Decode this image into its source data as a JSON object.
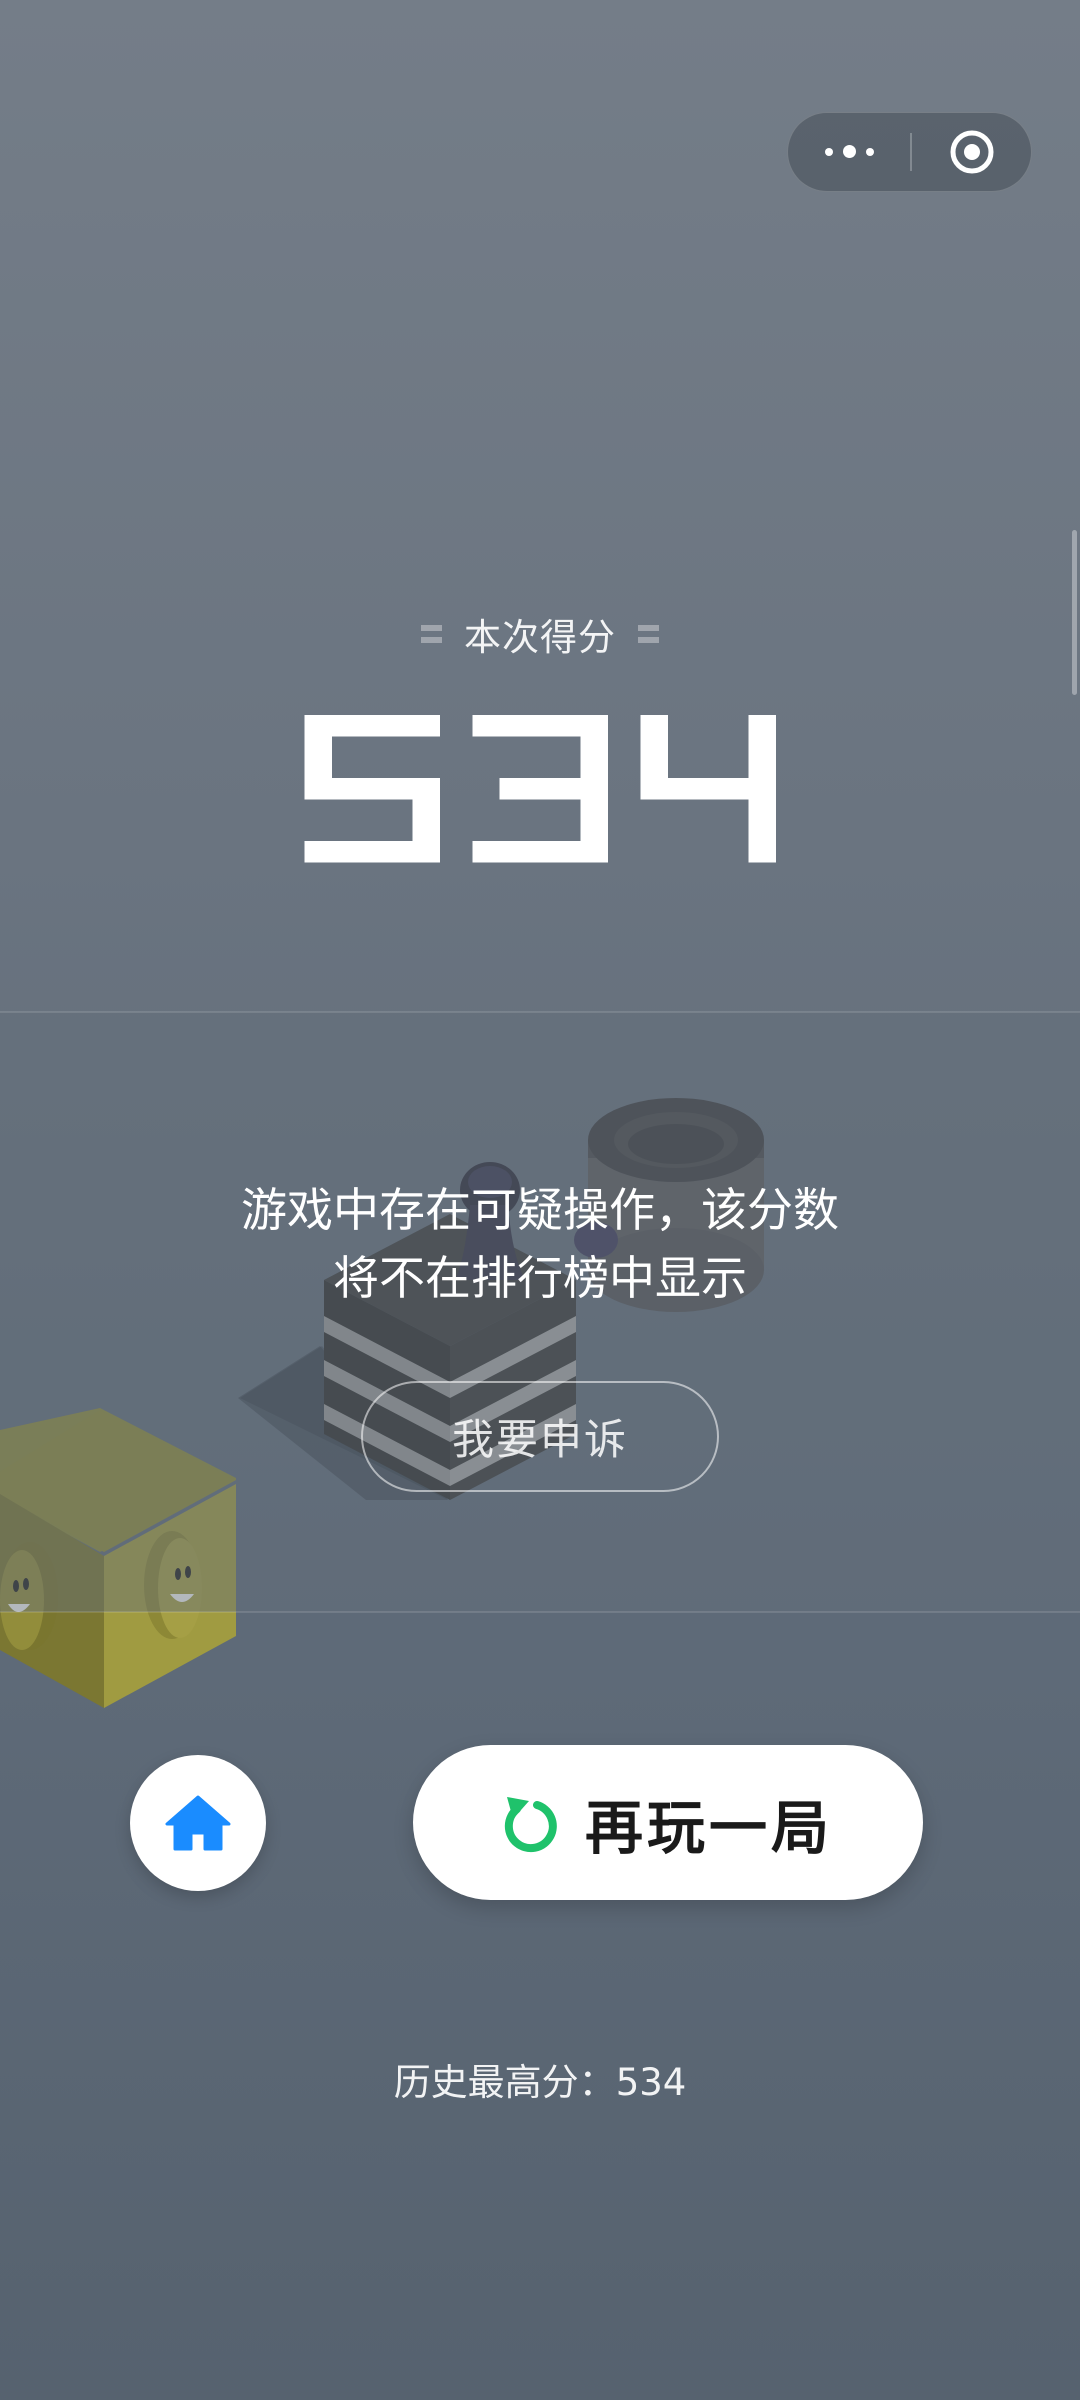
{
  "capsule": {
    "more_icon": "ellipsis-icon",
    "close_icon": "target-circle-icon"
  },
  "result": {
    "score_label": "本次得分",
    "score": "534"
  },
  "notice": {
    "line1": "游戏中存在可疑操作，该分数",
    "line2": "将不在排行榜中显示",
    "appeal_label": "我要申诉"
  },
  "actions": {
    "home_icon": "home-icon",
    "replay_icon": "refresh-icon",
    "replay_label": "再玩一局"
  },
  "best": {
    "label": "历史最高分：",
    "value": "534"
  },
  "colors": {
    "background_top": "#747d88",
    "background_bottom": "#56626f",
    "home_icon": "#1a8cff",
    "replay_icon": "#1fc26b",
    "button_bg": "#ffffff"
  }
}
